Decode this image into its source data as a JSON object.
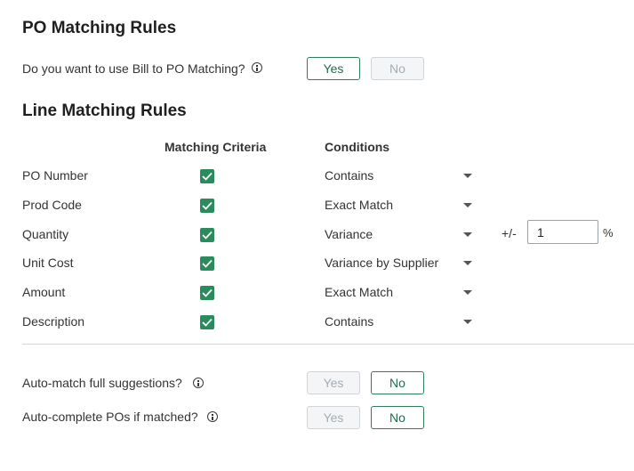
{
  "po_section": {
    "title": "PO Matching Rules",
    "question": "Do you want to use Bill to PO Matching?",
    "yes_label": "Yes",
    "no_label": "No",
    "selected": "Yes"
  },
  "line_section": {
    "title": "Line Matching Rules",
    "col_criteria": "Matching Criteria",
    "col_conditions": "Conditions",
    "rows": [
      {
        "label": "PO Number",
        "checked": true,
        "condition": "Contains"
      },
      {
        "label": "Prod Code",
        "checked": true,
        "condition": "Exact Match"
      },
      {
        "label": "Quantity",
        "checked": true,
        "condition": "Variance"
      },
      {
        "label": "Unit Cost",
        "checked": true,
        "condition": "Variance by Supplier"
      },
      {
        "label": "Amount",
        "checked": true,
        "condition": "Exact Match"
      },
      {
        "label": "Description",
        "checked": true,
        "condition": "Contains"
      }
    ],
    "variance": {
      "prefix": "+/-",
      "value": "1",
      "suffix": "%"
    }
  },
  "auto_match": {
    "question": "Auto-match full suggestions?",
    "yes_label": "Yes",
    "no_label": "No",
    "selected": "No"
  },
  "auto_complete": {
    "question": "Auto-complete POs if matched?",
    "yes_label": "Yes",
    "no_label": "No",
    "selected": "No"
  },
  "colors": {
    "accent": "#2a8c5d",
    "selected_border": "#2e7d5b",
    "disabled_bg": "#f3f5f7"
  }
}
